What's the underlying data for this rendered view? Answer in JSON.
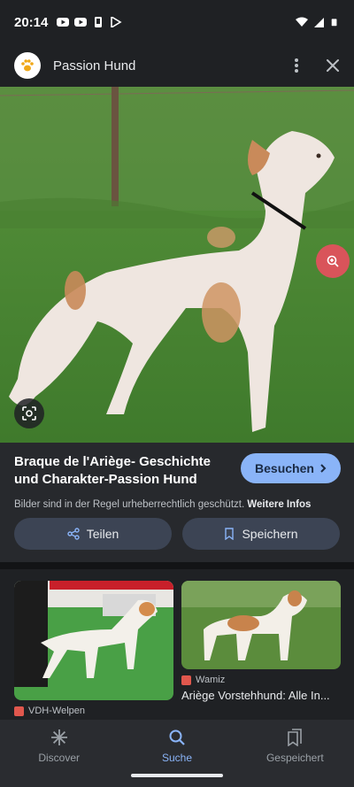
{
  "status_bar": {
    "time": "20:14"
  },
  "header": {
    "site_name": "Passion Hund"
  },
  "result": {
    "title": "Braque de l'Ariège- Geschichte und Charakter-Passion Hund",
    "visit_label": "Besuchen",
    "copyright_text": "Bilder sind in der Regel urheberrechtlich geschützt.",
    "more_info_label": "Weitere Infos",
    "share_label": "Teilen",
    "save_label": "Speichern"
  },
  "related": [
    {
      "source": "VDH-Welpen",
      "title": "",
      "source_color": "#e0574d"
    },
    {
      "source": "Wamiz",
      "title": "Ariège Vorstehhund: Alle In...",
      "source_color": "#e0574d"
    }
  ],
  "nav": [
    {
      "label": "Discover",
      "icon": "asterisk-icon",
      "active": false
    },
    {
      "label": "Suche",
      "icon": "search-icon",
      "active": true
    },
    {
      "label": "Gespeichert",
      "icon": "bookmarks-icon",
      "active": false
    }
  ],
  "colors": {
    "accent": "#8ab4f8",
    "zoom": "#d9545a",
    "background": "#1f2124"
  }
}
